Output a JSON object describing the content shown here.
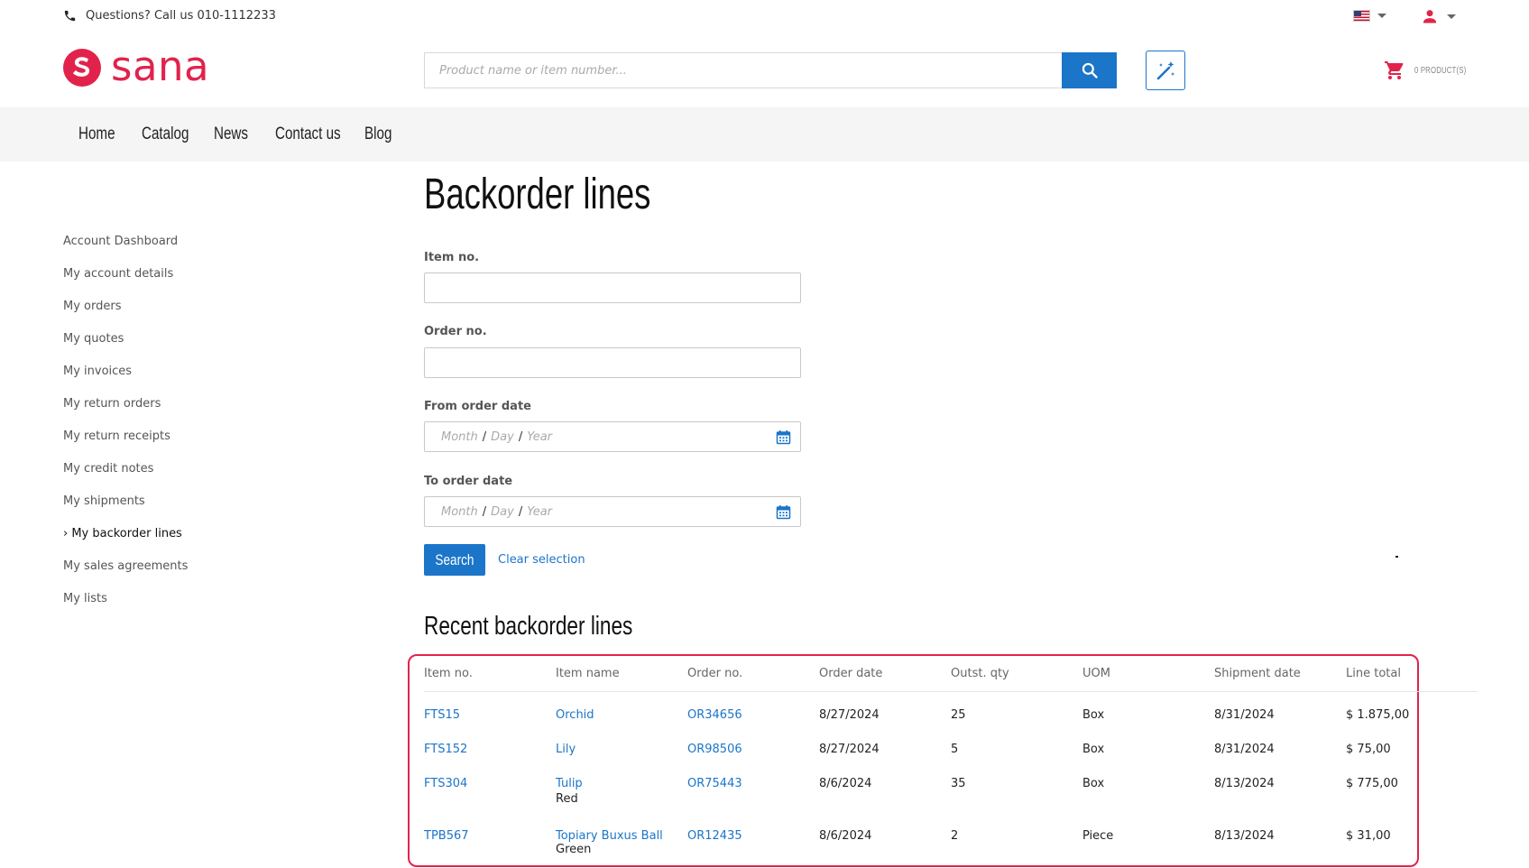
{
  "topbar": {
    "phone_text": "Questions? Call us 010-1112233"
  },
  "header": {
    "logo_text": "sana",
    "search_placeholder": "Product name or item number...",
    "cart_label": "0 PRODUCT(S)"
  },
  "nav": {
    "items": [
      "Home",
      "Catalog",
      "News",
      "Contact us",
      "Blog"
    ]
  },
  "sidebar": {
    "items": [
      "Account Dashboard",
      "My account details",
      "My orders",
      "My quotes",
      "My invoices",
      "My return orders",
      "My return receipts",
      "My credit notes",
      "My shipments",
      "› My backorder lines",
      "My sales agreements",
      "My lists"
    ]
  },
  "main": {
    "title": "Backorder lines",
    "form": {
      "item_label": "Item no.",
      "order_label": "Order no.",
      "from_label": "From order date",
      "to_label": "To order date",
      "date_month": "Month",
      "date_day": "Day",
      "date_year": "Year",
      "date_sep": "/",
      "search_button": "Search",
      "clear_link": "Clear selection"
    },
    "recent_title": "Recent backorder lines",
    "table": {
      "headers": [
        "Item no.",
        "Item name",
        "Order no.",
        "Order date",
        "Outst. qty",
        "UOM",
        "Shipment date",
        "Line total"
      ],
      "rows": [
        {
          "item_no": "FTS15",
          "item_name": "Orchid",
          "variant": "",
          "order_no": "OR34656",
          "order_date": "8/27/2024",
          "qty": "25",
          "uom": "Box",
          "ship_date": "8/31/2024",
          "total": "$ 1.875,00"
        },
        {
          "item_no": "FTS152",
          "item_name": "Lily",
          "variant": "",
          "order_no": "OR98506",
          "order_date": "8/27/2024",
          "qty": "5",
          "uom": "Box",
          "ship_date": "8/31/2024",
          "total": "$ 75,00"
        },
        {
          "item_no": "FTS304",
          "item_name": "Tulip",
          "variant": "Red",
          "order_no": "OR75443",
          "order_date": "8/6/2024",
          "qty": "35",
          "uom": "Box",
          "ship_date": "8/13/2024",
          "total": "$ 775,00"
        },
        {
          "item_no": "TPB567",
          "item_name": "Topiary Buxus Ball",
          "variant": "Green",
          "order_no": "OR12435",
          "order_date": "8/6/2024",
          "qty": "2",
          "uom": "Piece",
          "ship_date": "8/13/2024",
          "total": "$ 31,00"
        }
      ]
    }
  },
  "colors": {
    "brand": "#e1234c",
    "accent": "#1b75c9"
  }
}
